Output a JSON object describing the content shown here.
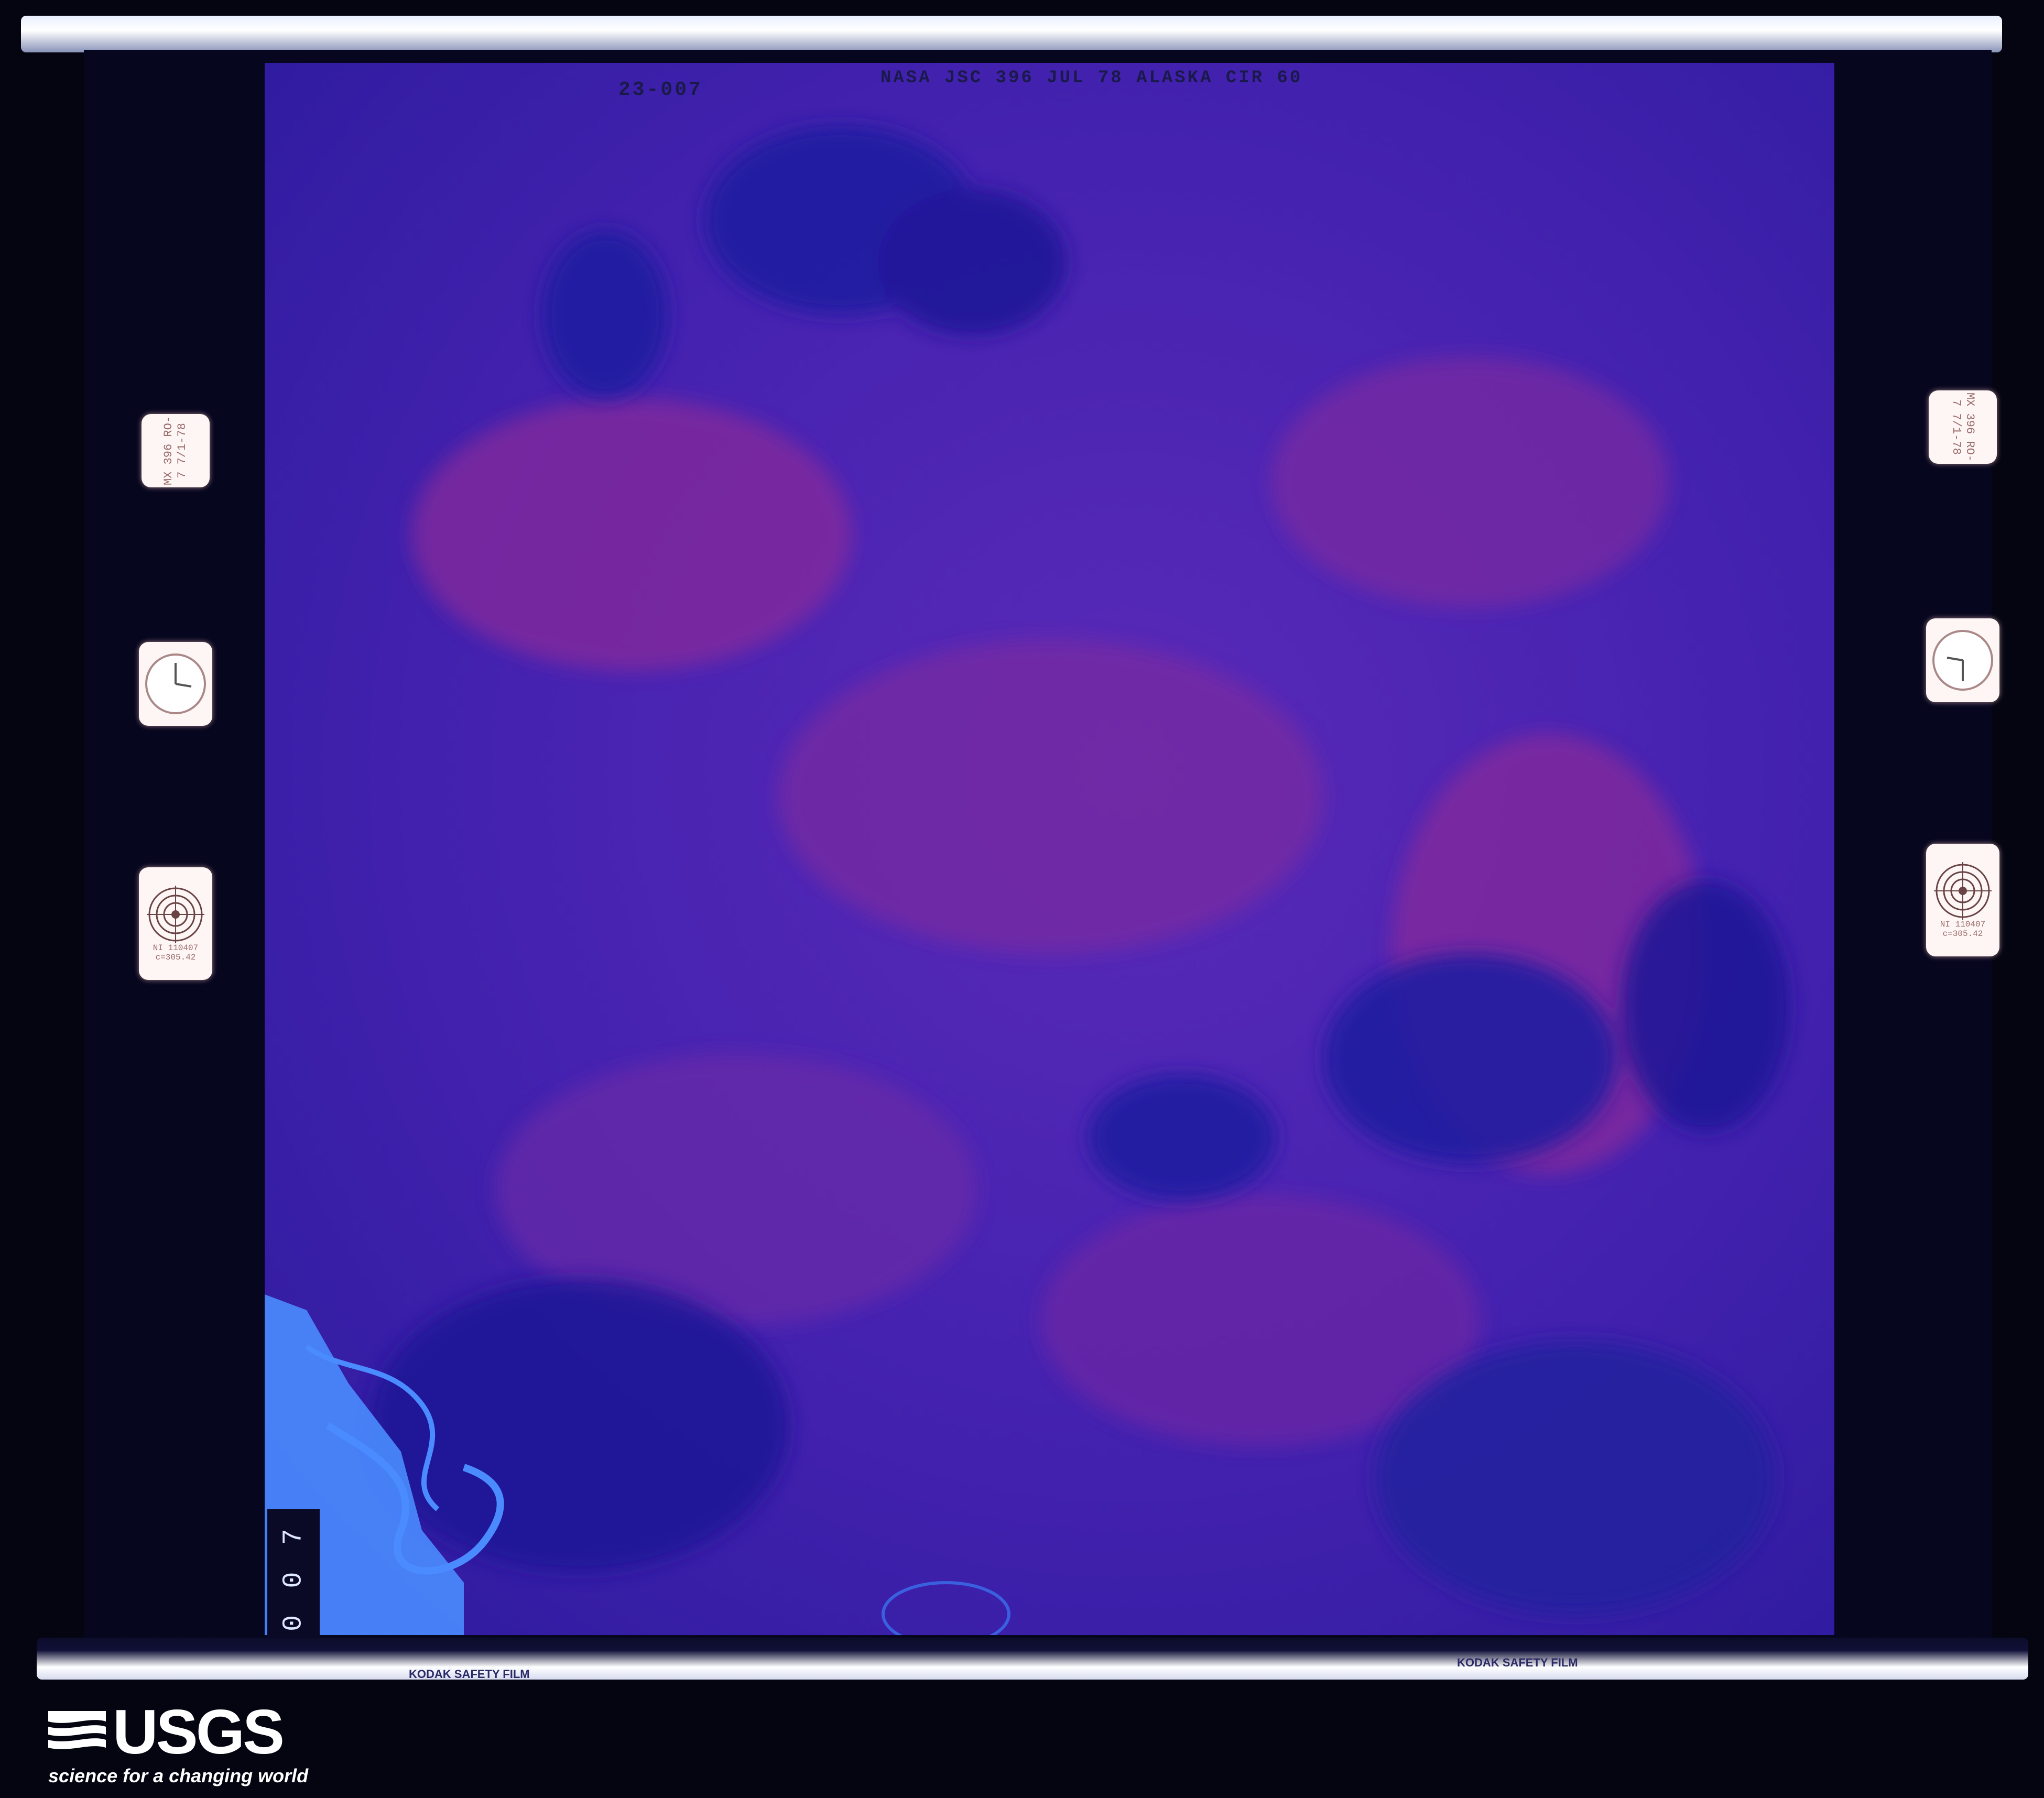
{
  "header_annotation": "23-007",
  "header_mission_text": "NASA JSC 396 JUL 78 ALASKA CIR 60",
  "frame_number": "0 0 7",
  "film_text_left": "KODAK SAFETY FILM",
  "film_text_right": "KODAK SAFETY FILM",
  "side_tags": {
    "left_id": "MX 396 RO-7 7/1-78",
    "right_id": "MX 396 RO-7 7/1-78",
    "left_lens": "NI 110407 c=305.42",
    "right_lens": "NI 110407 c=305.42"
  },
  "logo": {
    "name": "USGS",
    "tagline": "science for a changing world"
  },
  "colors": {
    "land_purple": "#3a1fa8",
    "land_magenta": "#8a2a9a",
    "water_blue": "#1c1aa0",
    "river_light": "#4a8cff",
    "background": "#050512"
  }
}
